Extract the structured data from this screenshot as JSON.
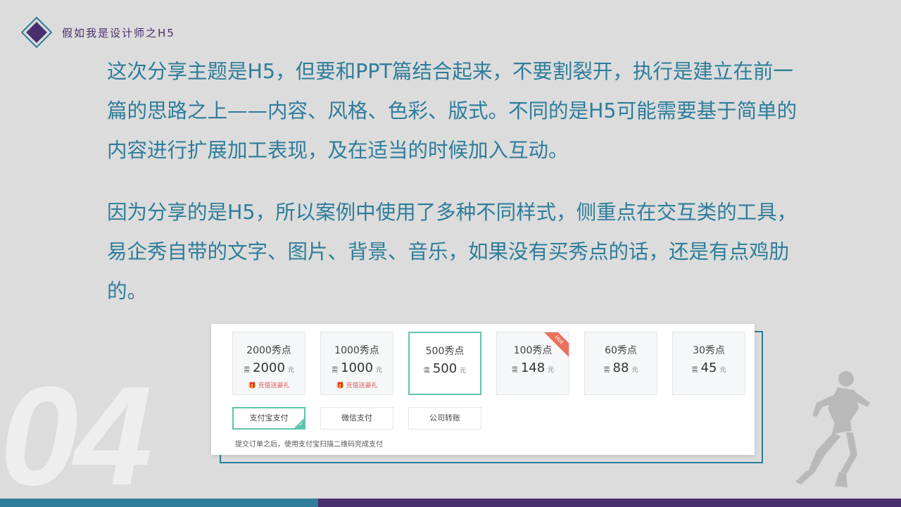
{
  "header": {
    "title": "假如我是设计师之H5"
  },
  "paragraphs": {
    "p1": "这次分享主题是H5，但要和PPT篇结合起来，不要割裂开，执行是建立在前一篇的思路之上——内容、风格、色彩、版式。不同的是H5可能需要基于简单的内容进行扩展加工表现，及在适当的时候加入互动。",
    "p2": "因为分享的是H5，所以案例中使用了多种不同样式，侧重点在交互类的工具，易企秀自带的文字、图片、背景、音乐，如果没有买秀点的话，还是有点鸡肋的。"
  },
  "watermark_number": "04",
  "packages": [
    {
      "name": "2000秀点",
      "price": "2000",
      "unit": "元",
      "gift": "充值送豪礼",
      "hot": ""
    },
    {
      "name": "1000秀点",
      "price": "1000",
      "unit": "元",
      "gift": "充值送豪礼",
      "hot": ""
    },
    {
      "name": "500秀点",
      "price": "500",
      "unit": "元",
      "gift": "",
      "hot": ""
    },
    {
      "name": "100秀点",
      "price": "148",
      "unit": "元",
      "gift": "",
      "hot": "Hot"
    },
    {
      "name": "60秀点",
      "price": "88",
      "unit": "元",
      "gift": "",
      "hot": ""
    },
    {
      "name": "30秀点",
      "price": "45",
      "unit": "元",
      "gift": "",
      "hot": ""
    }
  ],
  "selected_package": "500秀点",
  "coin_symbol": "需",
  "payment": {
    "methods": [
      "支付宝支付",
      "微信支付",
      "公司转账"
    ],
    "selected": "支付宝支付",
    "note": "提交订单之后，使用支付宝扫描二维码完成支付"
  },
  "colors": {
    "teal": "#2e7d9a",
    "purple": "#4a2f6e",
    "accent_green": "#5ec4ad",
    "hot_red": "#e9705a",
    "background": "#dcdcdc"
  }
}
